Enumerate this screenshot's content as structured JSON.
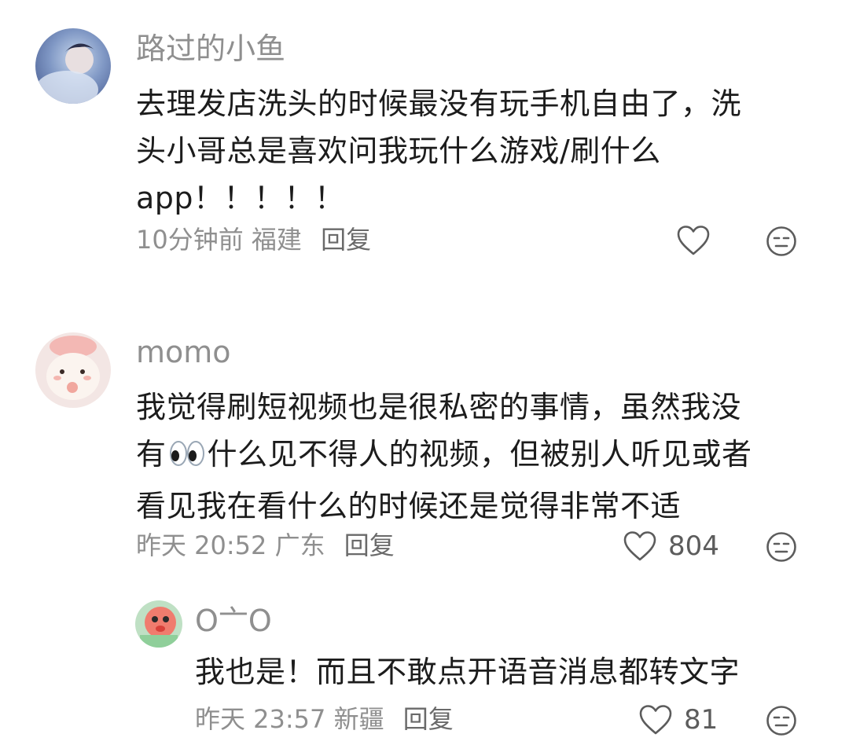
{
  "comments": [
    {
      "username": "路过的小鱼",
      "lines": [
        "去理发店洗头的时候最没有玩手机自由了，洗",
        "头小哥总是喜欢问我玩什么游戏/刷什么",
        "app！！！！！"
      ],
      "time": "10分钟前",
      "location": "福建",
      "reply_label": "回复",
      "likes": ""
    },
    {
      "username": "momo",
      "line1": "我觉得刷短视频也是很私密的事情，虽然我没",
      "line2_before": "有",
      "line2_after": "什么见不得人的视频，但被别人听见或者",
      "line3": "看见我在看什么的时候还是觉得非常不适",
      "time": "昨天 20:52",
      "location": "广东",
      "reply_label": "回复",
      "likes": "804"
    },
    {
      "username": "O亠O",
      "lines": [
        "我也是！而且不敢点开语音消息都转文字"
      ],
      "time": "昨天 23:57",
      "location": "新疆",
      "reply_label": "回复",
      "likes": "81"
    }
  ],
  "icons": {
    "like": "heart-outline-icon",
    "dislike": "meh-face-icon",
    "emoji": "eyes-emoji"
  },
  "colors": {
    "text": "#1c1c1c",
    "meta": "#8f8f8f",
    "icon": "#5c5c5c"
  }
}
